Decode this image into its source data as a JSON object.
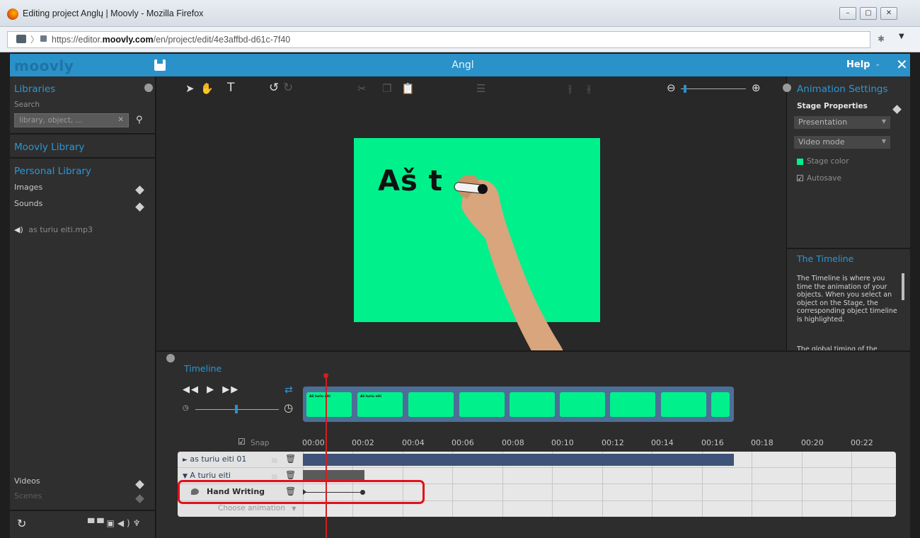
{
  "browser": {
    "window_title": "Editing project Anglų | Moovly - Mozilla Firefox",
    "url_prefix": "https://editor.",
    "url_domain": "moovly.com",
    "url_path": "/en/project/edit/4e3affbd-d61c-7f40",
    "minimize": "–",
    "maximize": "▢",
    "close": "✕"
  },
  "app": {
    "logo": "moovly",
    "project_name": "Angl",
    "help_label": "Help",
    "close_label": "✕"
  },
  "left_panel": {
    "libraries_title": "Libraries",
    "search_label": "Search",
    "search_placeholder": "library, object, ...",
    "moovly_library": "Moovly Library",
    "personal_library": "Personal Library",
    "images_label": "Images",
    "sounds_label": "Sounds",
    "sound_file": "as turiu eiti.mp3",
    "videos_label": "Videos",
    "scenes_label": "Scenes"
  },
  "stage": {
    "text": "Aš t"
  },
  "right_panel": {
    "title": "Animation Settings",
    "stage_properties": "Stage Properties",
    "presentation_select": "Presentation",
    "video_mode_select": "Video mode",
    "stage_color": "Stage color",
    "stage_color_value": "#00f08c",
    "autosave": "Autosave",
    "help_title": "The Timeline",
    "help_text": "The Timeline is where you time the animation of your objects. When you select an object on the Stage, the corresponding object timeline is highlighted.",
    "help_text2": "The global timing of the"
  },
  "timeline": {
    "title": "Timeline",
    "snap_label": "Snap",
    "thumb_text": "Aš turiu eiti",
    "timecodes": [
      "00:00",
      "00:02",
      "00:04",
      "00:06",
      "00:08",
      "00:10",
      "00:12",
      "00:14",
      "00:16",
      "00:18",
      "00:20",
      "00:22"
    ],
    "tracks": [
      {
        "name": "as turiu eiti 01",
        "arrow": "►"
      },
      {
        "name": "A turiu eiti",
        "arrow": "▼"
      },
      {
        "name": "Hand Writing",
        "arrow": ""
      }
    ],
    "choose_animation": "Choose animation",
    "playhead_color": "#d21e1e",
    "highlight_color": "#e0111b"
  }
}
